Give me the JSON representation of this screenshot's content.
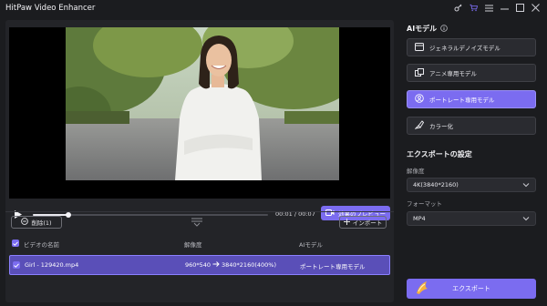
{
  "app": {
    "title": "HitPaw Video Enhancer"
  },
  "titlebar_icons": [
    "key-icon",
    "cart-icon",
    "menu-icon",
    "minimize-icon",
    "maximize-icon",
    "close-icon"
  ],
  "player": {
    "time_current": "00:01",
    "time_separator": "/",
    "time_total": "00:07",
    "progress_fraction": 0.15,
    "preview_label": "効果のプレビュー"
  },
  "list_toolbar": {
    "delete_label": "削除(1)",
    "import_label": "インポート"
  },
  "table": {
    "headers": [
      "ビデオの名前",
      "解像度",
      "AIモデル"
    ],
    "rows": [
      {
        "name": "Girl - 129420.mp4",
        "resolution_from": "960*540",
        "resolution_to": "3840*2160(400%)",
        "model": "ポートレート専用モデル"
      }
    ]
  },
  "sidebar": {
    "ai_title": "AIモデル",
    "models": [
      {
        "label": "ジェネラルデノイズモデル",
        "icon": "denoise-icon",
        "active": false
      },
      {
        "label": "アニメ専用モデル",
        "icon": "anime-icon",
        "active": false
      },
      {
        "label": "ポートレート専用モデル",
        "icon": "portrait-icon",
        "active": true
      },
      {
        "label": "カラー化",
        "icon": "colorize-icon",
        "active": false
      }
    ],
    "export_settings_title": "エクスポートの設定",
    "resolution_label": "解像度",
    "resolution_value": "4K(3840*2160)",
    "format_label": "フォーマット",
    "format_value": "MP4",
    "export_label": "エクスポート"
  },
  "colors": {
    "accent": "#7b6cf0",
    "background": "#1b1c1f",
    "panel": "#232428"
  }
}
